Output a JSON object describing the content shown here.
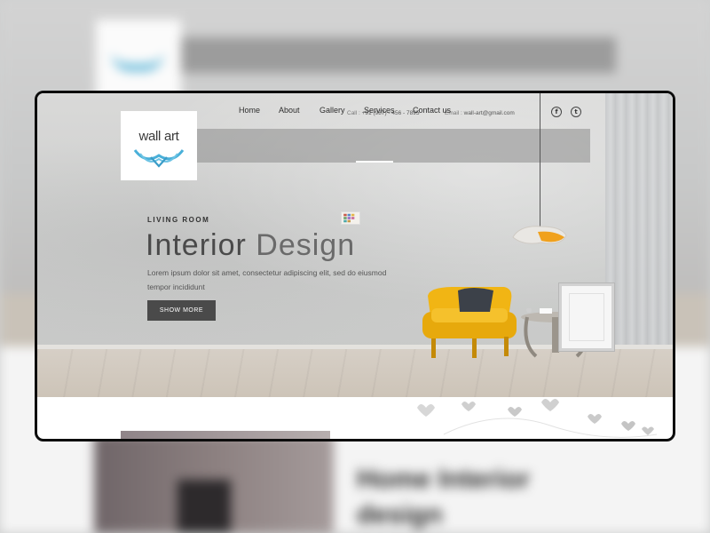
{
  "background_page": {
    "heading": "Home Interior\ndesign"
  },
  "brand": {
    "logo_text": "wall art",
    "logo_color": "#4ab0d9"
  },
  "contact": {
    "phone_label": "Call : ",
    "phone_value": "+91 (987) - 456 - 7895",
    "email_label": "Email : ",
    "email_value": "wall-art@gmail.com"
  },
  "social": [
    {
      "icon": "facebook-icon",
      "glyph": "f"
    },
    {
      "icon": "twitter-icon",
      "glyph": "t"
    }
  ],
  "nav": {
    "items": [
      "Home",
      "About",
      "Gallery",
      "Services",
      "Contact us"
    ],
    "active": "Home"
  },
  "hero": {
    "kicker": "LIVING ROOM",
    "title_part1": "Interior",
    "title_part2": "Design",
    "description": "Lorem ipsum dolor sit amet, consectetur adipiscing elit, sed do eiusmod tempor incididunt",
    "cta_label": "SHOW MORE"
  },
  "colors": {
    "chair": "#f1b514",
    "cushion": "#3c4149",
    "lamp_inner": "#f0a11d",
    "button": "#4a4a4a",
    "frame_border": "#0c0c0c"
  }
}
